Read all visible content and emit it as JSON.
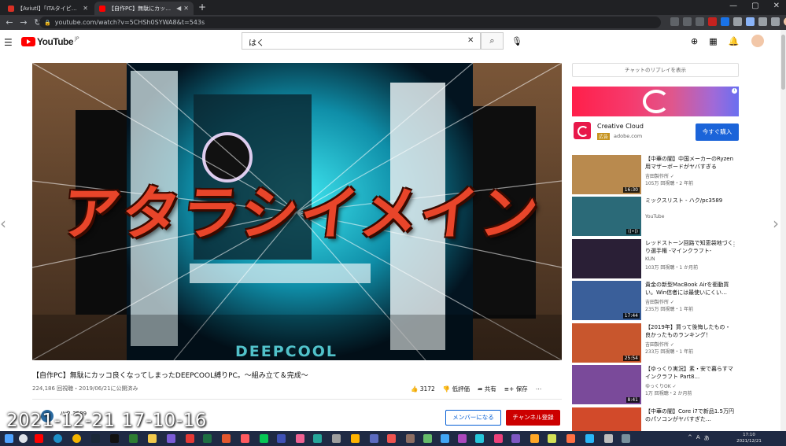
{
  "browser": {
    "tabs": [
      {
        "title": "【Aviutl】「ITAタイピング」でPCタイピング",
        "active": false,
        "favicon_color": "#d93025"
      },
      {
        "title": "【自作PC】無駄にカッコ良くなってしまった",
        "active": true,
        "favicon_color": "#ff0000"
      }
    ],
    "new_tab": "+",
    "url": "youtube.com/watch?v=5CHSh0SYWA8&t=543s",
    "window_controls": [
      "—",
      "▢",
      "✕"
    ]
  },
  "header": {
    "logo_text": "YouTube",
    "logo_region": "JP",
    "search_value": "はく",
    "brand_color": "#ff0000"
  },
  "video": {
    "overlay_text": "アタラシイメイン",
    "brand_on_case": "DEEPCOOL",
    "title": "【自作PC】無駄にカッコ良くなってしまったDEEPCOOL縛りPC。～組み立て＆完成～",
    "meta": "224,186 回視聴・2019/06/21に公開済み",
    "likes": "3172",
    "dislike_label": "低評価",
    "share_label": "共有",
    "save_label": "保存",
    "channel_name": "ハク.3589",
    "member_label": "メンバーになる",
    "subscribe_label": "チャンネル登録"
  },
  "recording_timestamp": "2021-12-21 17-10-16",
  "sidebar": {
    "chat_replay": "チャットのリプレイを表示",
    "ad": {
      "name": "Creative Cloud",
      "badge": "広告",
      "domain": "adobe.com",
      "cta": "今すぐ購入"
    },
    "recommendations": [
      {
        "title": "【中華の闇】中国メーカーのRyzen用マザーボードがヤバすぎる",
        "channel": "吉田製作所 ✓",
        "meta": "105万 回視聴・2 年前",
        "duration": "16:30",
        "thumb_color": "#b98a4e"
      },
      {
        "title": "ミックスリスト - ハク/pc3589",
        "channel": "YouTube",
        "meta": "",
        "duration": "((•))",
        "thumb_color": "#2b6a78"
      },
      {
        "title": "レッドストーン回路で知恵袋地づくり選手権 -マインクラフト-",
        "channel": "KUN",
        "meta": "103万 回視聴・1 か月前",
        "duration": "",
        "thumb_color": "#2a1f36"
      },
      {
        "title": "貴金の新型MacBook Airを衝動買い。Win信者には最使いにくい…",
        "channel": "吉田製作所 ✓",
        "meta": "235万 回視聴・1 年前",
        "duration": "17:44",
        "thumb_color": "#3a5f9a"
      },
      {
        "title": "【2019年】買って後悔したもの・良かったものランキング！",
        "channel": "吉田製作所 ✓",
        "meta": "233万 回視聴・1 年前",
        "duration": "25:54",
        "thumb_color": "#c8562d"
      },
      {
        "title": "【ゆっくり実況】素・安で暮らすマインクラフト Part8...",
        "channel": "ゆっくりOK ✓",
        "meta": "1万 回視聴・2 か月前",
        "duration": "8:41",
        "thumb_color": "#7a4a9a"
      },
      {
        "title": "【中華の闇】Core i7で新品1.5万円のパソコンがヤバすぎた…",
        "channel": "",
        "meta": "",
        "duration": "",
        "thumb_color": "#d24a2a"
      }
    ]
  },
  "taskbar": {
    "tray": [
      "^",
      "A",
      "あ"
    ],
    "time": "17:10",
    "date": "2021/12/21"
  }
}
